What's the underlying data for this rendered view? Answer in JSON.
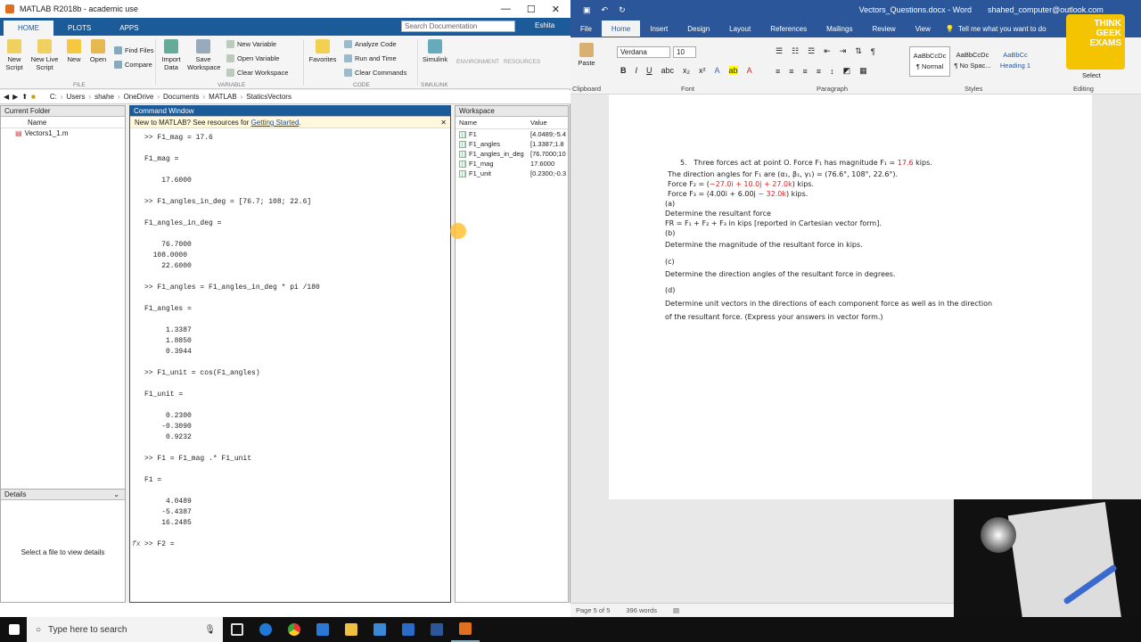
{
  "matlab": {
    "title": "MATLAB R2018b - academic use",
    "window_controls": [
      "—",
      "☐",
      "✕"
    ],
    "tabs": [
      "HOME",
      "PLOTS",
      "APPS"
    ],
    "search_placeholder": "Search Documentation",
    "user": "Eshita",
    "ribbon": {
      "new_script": "New Script",
      "new_live_script": "New Live Script",
      "new": "New",
      "open": "Open",
      "find_files": "Find Files",
      "compare": "Compare",
      "import_data": "Import Data",
      "save_workspace": "Save Workspace",
      "new_variable": "New Variable",
      "open_variable": "Open Variable",
      "clear_workspace": "Clear Workspace",
      "favorites": "Favorites",
      "analyze_code": "Analyze Code",
      "run_and_time": "Run and Time",
      "clear_commands": "Clear Commands",
      "simulink": "Simulink",
      "environment": "ENVIRONMENT",
      "resources": "RESOURCES",
      "groups": [
        "FILE",
        "VARIABLE",
        "CODE",
        "SIMULINK"
      ]
    },
    "path": [
      "C:",
      "Users",
      "shahe",
      "OneDrive",
      "Documents",
      "MATLAB",
      "StaticsVectors"
    ],
    "current_folder": {
      "title": "Current Folder",
      "col": "Name",
      "files": [
        "Vectors1_1.m"
      ]
    },
    "details": {
      "title": "Details",
      "hint": "Select a file to view details"
    },
    "command_window": {
      "title": "Command Window",
      "banner_text": "New to MATLAB? See resources for ",
      "banner_link": "Getting Started",
      "banner_end": ".",
      "lines": [
        ">> F1_mag = 17.6",
        "",
        "F1_mag =",
        "",
        "    17.6000",
        "",
        ">> F1_angles_in_deg = [76.7; 108; 22.6]",
        "",
        "F1_angles_in_deg =",
        "",
        "    76.7000",
        "  108.0000",
        "    22.6000",
        "",
        ">> F1_angles = F1_angles_in_deg * pi /180",
        "",
        "F1_angles =",
        "",
        "     1.3387",
        "     1.8850",
        "     0.3944",
        "",
        ">> F1_unit = cos(F1_angles)",
        "",
        "F1_unit =",
        "",
        "     0.2300",
        "    -0.3090",
        "     0.9232",
        "",
        ">> F1 = F1_mag .* F1_unit",
        "",
        "F1 =",
        "",
        "     4.0489",
        "    -5.4387",
        "    16.2485",
        "",
        ">> F2 = "
      ],
      "prompt_icon": "fx"
    },
    "workspace": {
      "title": "Workspace",
      "col_name": "Name",
      "col_value": "Value",
      "vars": [
        {
          "name": "F1",
          "value": "[4.0489;-5.4"
        },
        {
          "name": "F1_angles",
          "value": "[1.3387;1.8"
        },
        {
          "name": "F1_angles_in_deg",
          "value": "[76.7000;10"
        },
        {
          "name": "F1_mag",
          "value": "17.6000"
        },
        {
          "name": "F1_unit",
          "value": "[0.2300;-0.3"
        }
      ]
    }
  },
  "word": {
    "title": "Vectors_Questions.docx - Word",
    "account": "shahed_computer@outlook.com",
    "tabs": [
      "File",
      "Home",
      "Insert",
      "Design",
      "Layout",
      "References",
      "Mailings",
      "Review",
      "View"
    ],
    "tell_me": "Tell me what you want to do",
    "font": "Verdana",
    "size": "10",
    "styles": [
      {
        "preview": "AaBbCcDc",
        "name": "¶ Normal"
      },
      {
        "preview": "AaBbCcDc",
        "name": "¶ No Spac..."
      },
      {
        "preview": "AaBbCc",
        "name": "Heading 1"
      }
    ],
    "select": "Select",
    "groups": [
      "Clipboard",
      "Font",
      "Paragraph",
      "Styles",
      "Editing"
    ],
    "paste": "Paste",
    "doc": {
      "q_num": "5.",
      "q_intro": "Three forces act at point O. Force F₁ has magnitude F₁ = ",
      "q_mag": "17.6",
      "q_unit": " kips.",
      "angles_pre": "The direction angles for F₁ are (α₁, β₁, γ₁) = (76.6°, 108°, 22.6°).",
      "f2_pre": "Force F₂ = (",
      "f2_val": "−27.0i + 10.0j + 27.0k",
      "f2_post": ") kips.",
      "f3_pre": "Force F₃ = (4.00i + 6.00j ",
      "f3_val": "− 32.0k",
      "f3_post": ") kips.",
      "a_label": "(a)",
      "a_text": "Determine the resultant force",
      "a_formula": "FR = F₁ + F₂ + F₃ in kips [reported in Cartesian vector form].",
      "b_label": "(b)",
      "b_text": "Determine the magnitude of the resultant force in kips.",
      "c_label": "(c)",
      "c_text": "Determine the direction angles of the resultant force in degrees.",
      "d_label": "(d)",
      "d_text1": "Determine unit vectors in the directions of each component force as well as in the direction",
      "d_text2": "of the resultant force. (Express your answers in vector form.)"
    },
    "status": {
      "page": "Page 5 of 5",
      "words": "396 words"
    }
  },
  "logo": {
    "l1": "THINK",
    "l2": "GEEK",
    "l3": "EXAMS"
  },
  "taskbar": {
    "search": "Type here to search"
  },
  "colors": {
    "matlab_blue": "#1c5b9a",
    "word_blue": "#2b579a",
    "red": "#d22222"
  }
}
